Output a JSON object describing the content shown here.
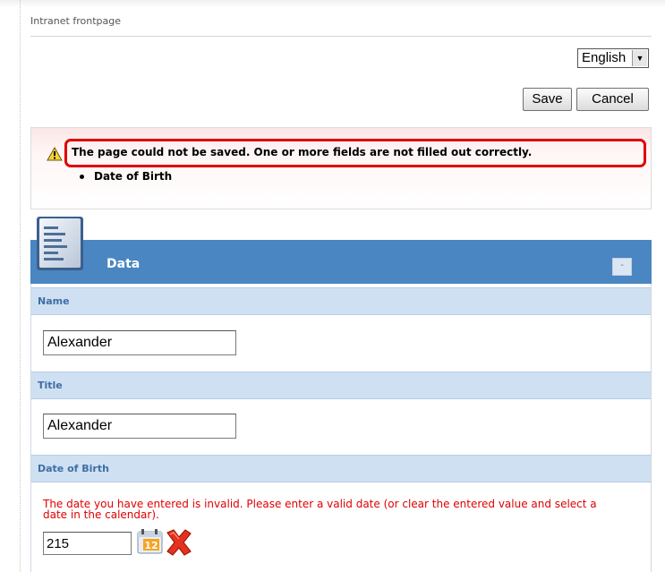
{
  "breadcrumb": "Intranet frontpage",
  "language": {
    "selected": "English"
  },
  "toolbar": {
    "save_label": "Save",
    "cancel_label": "Cancel"
  },
  "message": {
    "text": "The page could not be saved. One or more fields are not filled out correctly.",
    "items": [
      "Date of Birth"
    ]
  },
  "panel": {
    "title": "Data",
    "collapse_label": "-",
    "fields": {
      "name": {
        "label": "Name",
        "value": "Alexander"
      },
      "title": {
        "label": "Title",
        "value": "Alexander"
      },
      "dob": {
        "label": "Date of Birth",
        "error": "The date you have entered is invalid. Please enter a valid date (or clear the entered value and select a date in the calendar).",
        "value": "215",
        "calendar_day": "12"
      }
    }
  },
  "colors": {
    "header_blue": "#4a86c1",
    "field_header": "#cfe0f3",
    "error_red": "#e00000",
    "highlight_red": "#e00000"
  },
  "icons": [
    "warning-icon",
    "document-icon",
    "calendar-icon",
    "clear-icon"
  ]
}
